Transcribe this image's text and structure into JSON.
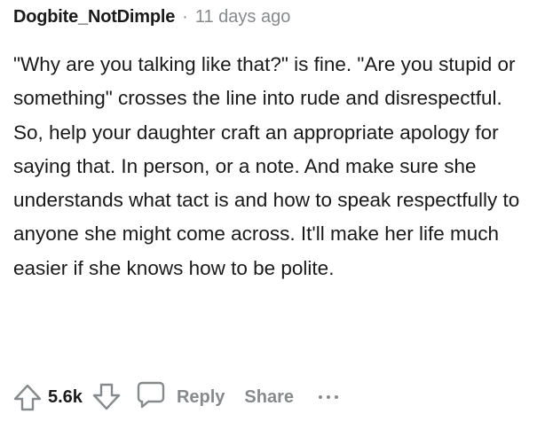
{
  "comment": {
    "author": "Dogbite_NotDimple",
    "separator": "·",
    "timestamp": "11 days ago",
    "body": "\"Why are you talking like that?\" is fine. \"Are you stupid or something\" crosses the line into rude and disrespectful. So, help your daughter craft an appropriate apology for saying that. In person, or a note. And make sure she understands what tact is and how to speak respectfully to anyone she might come across. It'll make her life much easier if she knows how to be polite."
  },
  "actions": {
    "upvote_icon": "arrow-up-outline-icon",
    "score": "5.6k",
    "downvote_icon": "arrow-down-outline-icon",
    "reply_icon": "speech-bubble-icon",
    "reply_label": "Reply",
    "share_label": "Share",
    "more_icon": "ellipsis-icon"
  },
  "colors": {
    "text": "#1a1a1b",
    "meta": "#878a8c",
    "background": "#ffffff"
  }
}
